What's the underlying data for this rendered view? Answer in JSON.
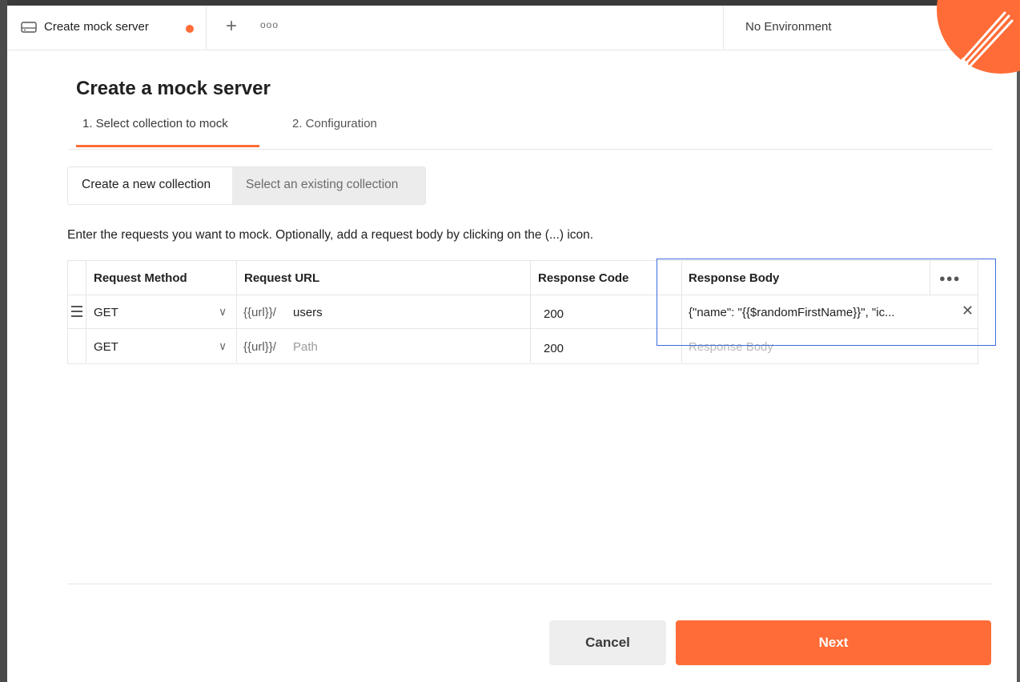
{
  "tabbar": {
    "tab_label": "Create mock server",
    "more_label": "ooo",
    "environment": "No Environment"
  },
  "page": {
    "title": "Create a mock server",
    "steps": [
      "1. Select collection to mock",
      "2. Configuration"
    ],
    "active_step": 0
  },
  "toggle": {
    "option_new": "Create a new collection",
    "option_existing": "Select an existing collection",
    "selected": "new"
  },
  "instructions": "Enter the requests you want to mock. Optionally, add a request body by clicking on the (...) icon.",
  "table": {
    "headers": [
      "Request Method",
      "Request URL",
      "Response Code",
      "Response Body"
    ],
    "rows": [
      {
        "method": "GET",
        "url_prefix": "{{url}}/",
        "path": "users",
        "code": "200",
        "body": "{\"name\": \"{{$randomFirstName}}\", \"ic..."
      },
      {
        "method": "GET",
        "url_prefix": "{{url}}/",
        "path_placeholder": "Path",
        "code": "200",
        "body_placeholder": "Response Body"
      }
    ]
  },
  "footer": {
    "cancel_label": "Cancel",
    "next_label": "Next"
  },
  "colors": {
    "accent": "#ff6c37",
    "highlight_box": "#3a6de0"
  }
}
